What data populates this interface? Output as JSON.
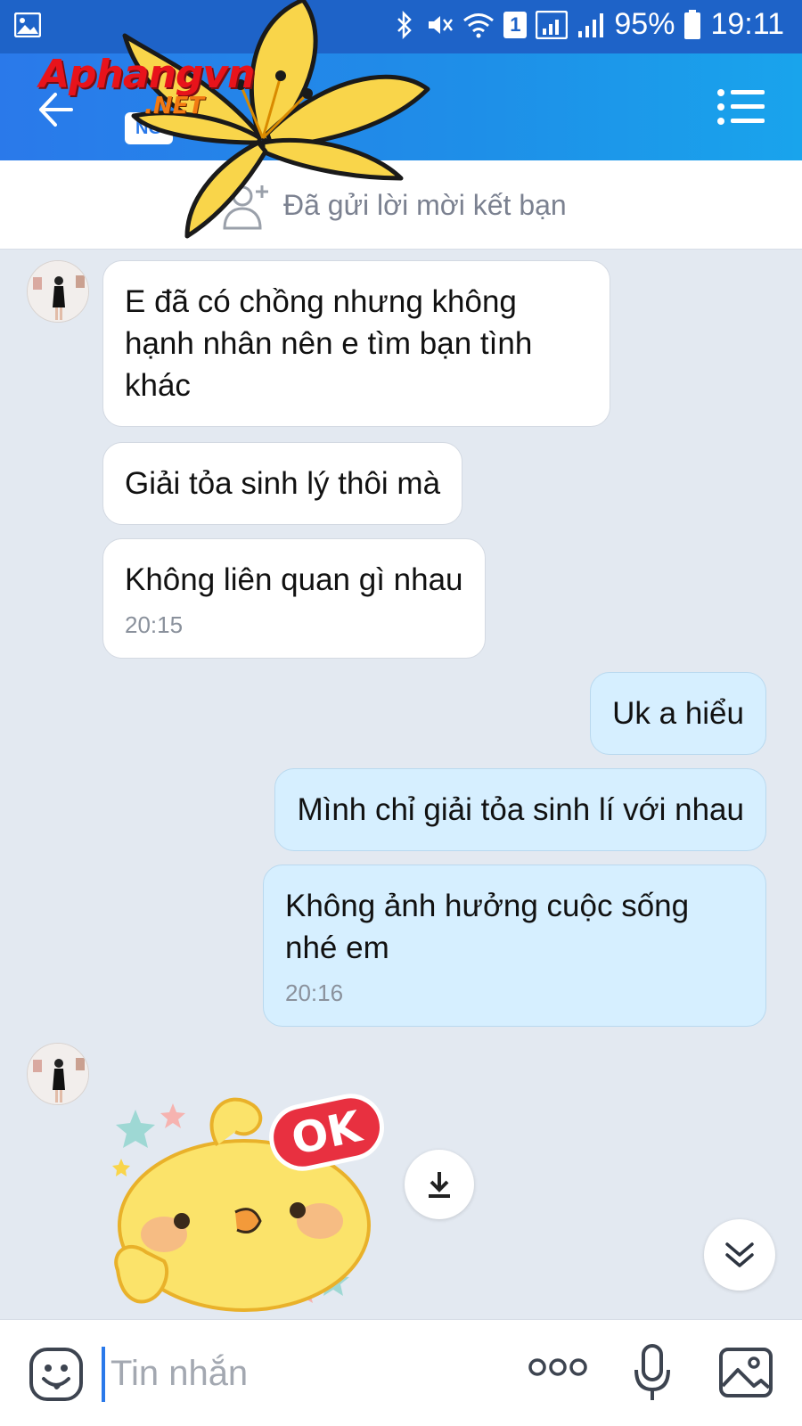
{
  "status_bar": {
    "battery": "95%",
    "time": "19:11",
    "sim_badge": "1"
  },
  "header": {
    "contact_badge": "NG",
    "logo_text": "Aphangvn",
    "logo_sub": ".NET"
  },
  "friend_request": {
    "label": "Đã gửi lời mời kết bạn"
  },
  "messages": [
    {
      "side": "in",
      "text": "E đã có chồng nhưng không hạnh nhân nên e tìm bạn tình khác"
    },
    {
      "side": "in",
      "text": "Giải tỏa sinh lý thôi mà"
    },
    {
      "side": "in",
      "text": "Không liên quan gì nhau",
      "time": "20:15"
    },
    {
      "side": "out",
      "text": "Uk a hiểu"
    },
    {
      "side": "out",
      "text": "Mình chỉ giải tỏa sinh lí với nhau"
    },
    {
      "side": "out",
      "text": "Không ảnh hưởng cuộc sống nhé em",
      "time": "20:16"
    }
  ],
  "sticker": {
    "label": "OK"
  },
  "input": {
    "placeholder": "Tin nhắn"
  },
  "icons": {
    "back": "arrow-left-icon",
    "menu": "list-menu-icon",
    "add_friend": "add-user-icon",
    "download": "download-icon",
    "scroll_down": "double-chevron-down-icon",
    "emoji": "emoji-icon",
    "more": "more-dots-icon",
    "mic": "microphone-icon",
    "image": "image-icon"
  },
  "colors": {
    "header": "#1e8fe8",
    "incoming_bubble": "#ffffff",
    "outgoing_bubble": "#d6efff",
    "chat_background": "#e3e9f1"
  }
}
